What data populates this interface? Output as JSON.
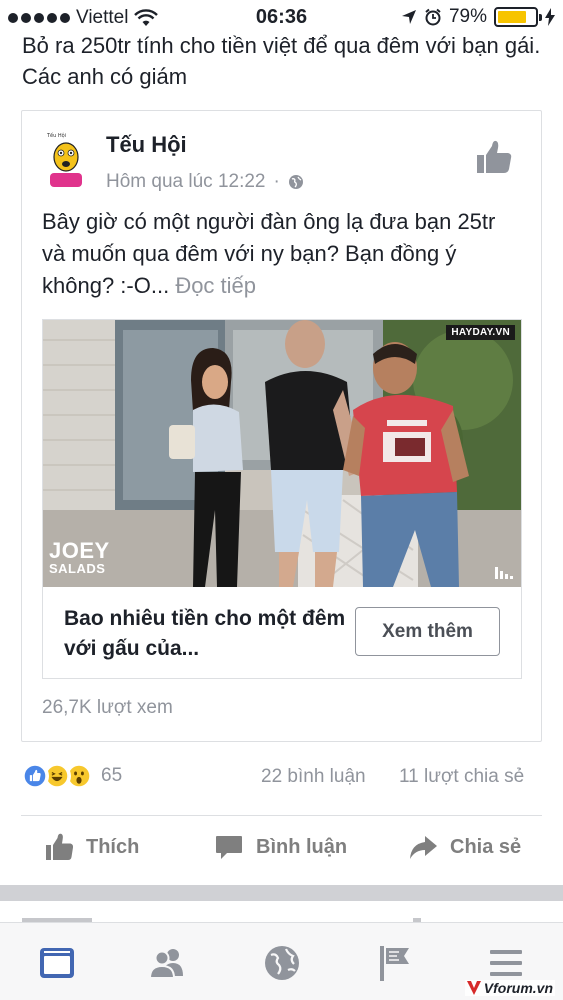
{
  "status_bar": {
    "carrier": "Viettel",
    "time": "06:36",
    "battery_text": "79%",
    "battery_level": 0.79
  },
  "post": {
    "text": "Bỏ ra 250tr tính cho tiền việt để qua đêm với bạn gái. Các anh có giám"
  },
  "shared_post": {
    "page_name": "Tếu Hội",
    "timestamp": "Hôm qua lúc 12:22",
    "separator": "·",
    "text": "Bây giờ có một người đàn ông lạ đưa bạn 25tr và muốn qua đêm với ny bạn? Bạn đồng ý không? :-O...",
    "see_more": "Đọc tiếp",
    "video_badge": "HAYDAY.VN",
    "video_logo_line1": "JOEY",
    "video_logo_line2": "SALADS",
    "link_title": "Bao nhiêu tiền cho một đêm với gấu của...",
    "cta_label": "Xem thêm",
    "views": "26,7K lượt xem"
  },
  "stats": {
    "reaction_count": "65",
    "comments": "22 bình luận",
    "shares": "11 lượt chia sẻ"
  },
  "actions": {
    "like": "Thích",
    "comment": "Bình luận",
    "share": "Chia sẻ"
  },
  "tab_bar": {
    "items": [
      "news-feed-icon",
      "friends-icon",
      "globe-icon",
      "pages-flag-icon",
      "menu-icon"
    ]
  },
  "watermark": "Vforum.vn",
  "colors": {
    "brand_blue": "#4267b2",
    "reaction_yellow": "#f7c82d",
    "battery_yellow": "#f7c400",
    "muted_text": "#90949c"
  }
}
